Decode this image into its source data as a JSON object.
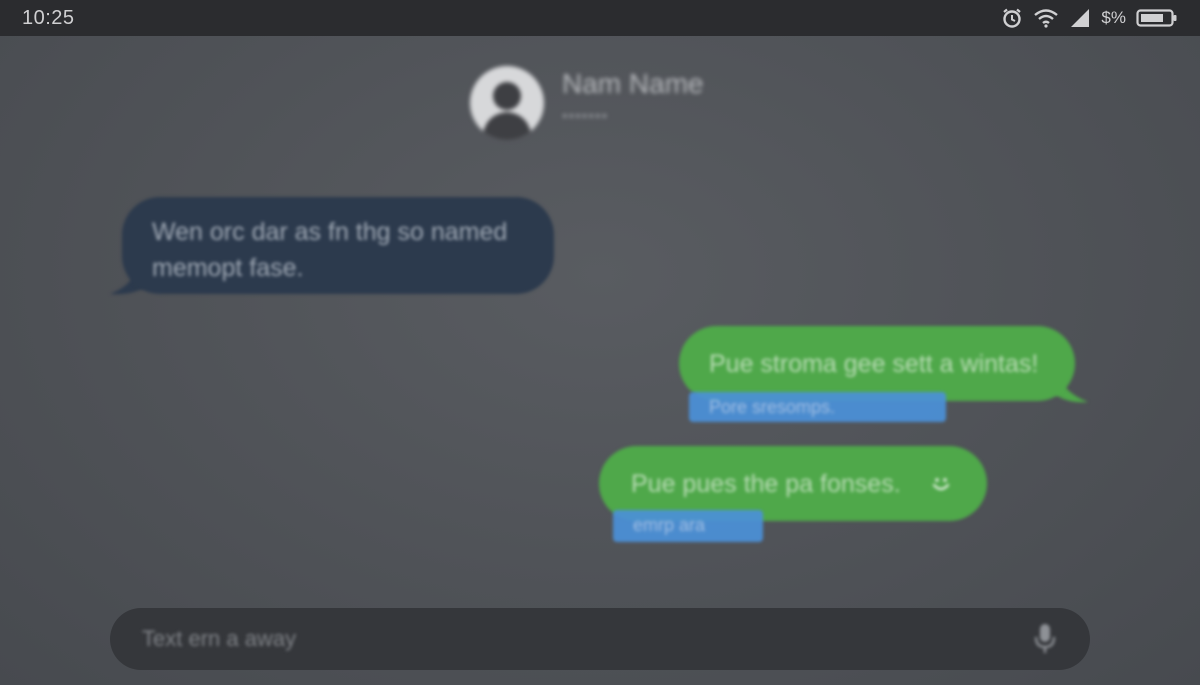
{
  "status_bar": {
    "time": "10:25",
    "battery_text": "$%",
    "icons": [
      "alarm-icon",
      "wifi-icon",
      "signal-icon",
      "battery-icon"
    ]
  },
  "contact": {
    "name": "Nam Name",
    "subtitle": "•••••••",
    "avatar_icon": "person-icon"
  },
  "messages": [
    {
      "direction": "incoming",
      "text": "Wen orc dar as fn thg so named memopt fase."
    },
    {
      "direction": "outgoing",
      "text": "Pue stroma gee sett a wintas!",
      "highlight": "Pore sresomps."
    },
    {
      "direction": "outgoing",
      "text": "Pue pues the pa fonses.",
      "highlight": "emrp ara",
      "reaction_icon": "smiley-icon"
    }
  ],
  "composer": {
    "placeholder": "Text ern a away",
    "mic_icon": "microphone-icon"
  },
  "colors": {
    "status_bar_bg": "#2b2c2f",
    "background": "#4f5257",
    "incoming_bubble": "#2c3a4d",
    "outgoing_bubble": "#4fa84a",
    "highlight": "#4b91d9",
    "composer_bg": "#35373b"
  }
}
